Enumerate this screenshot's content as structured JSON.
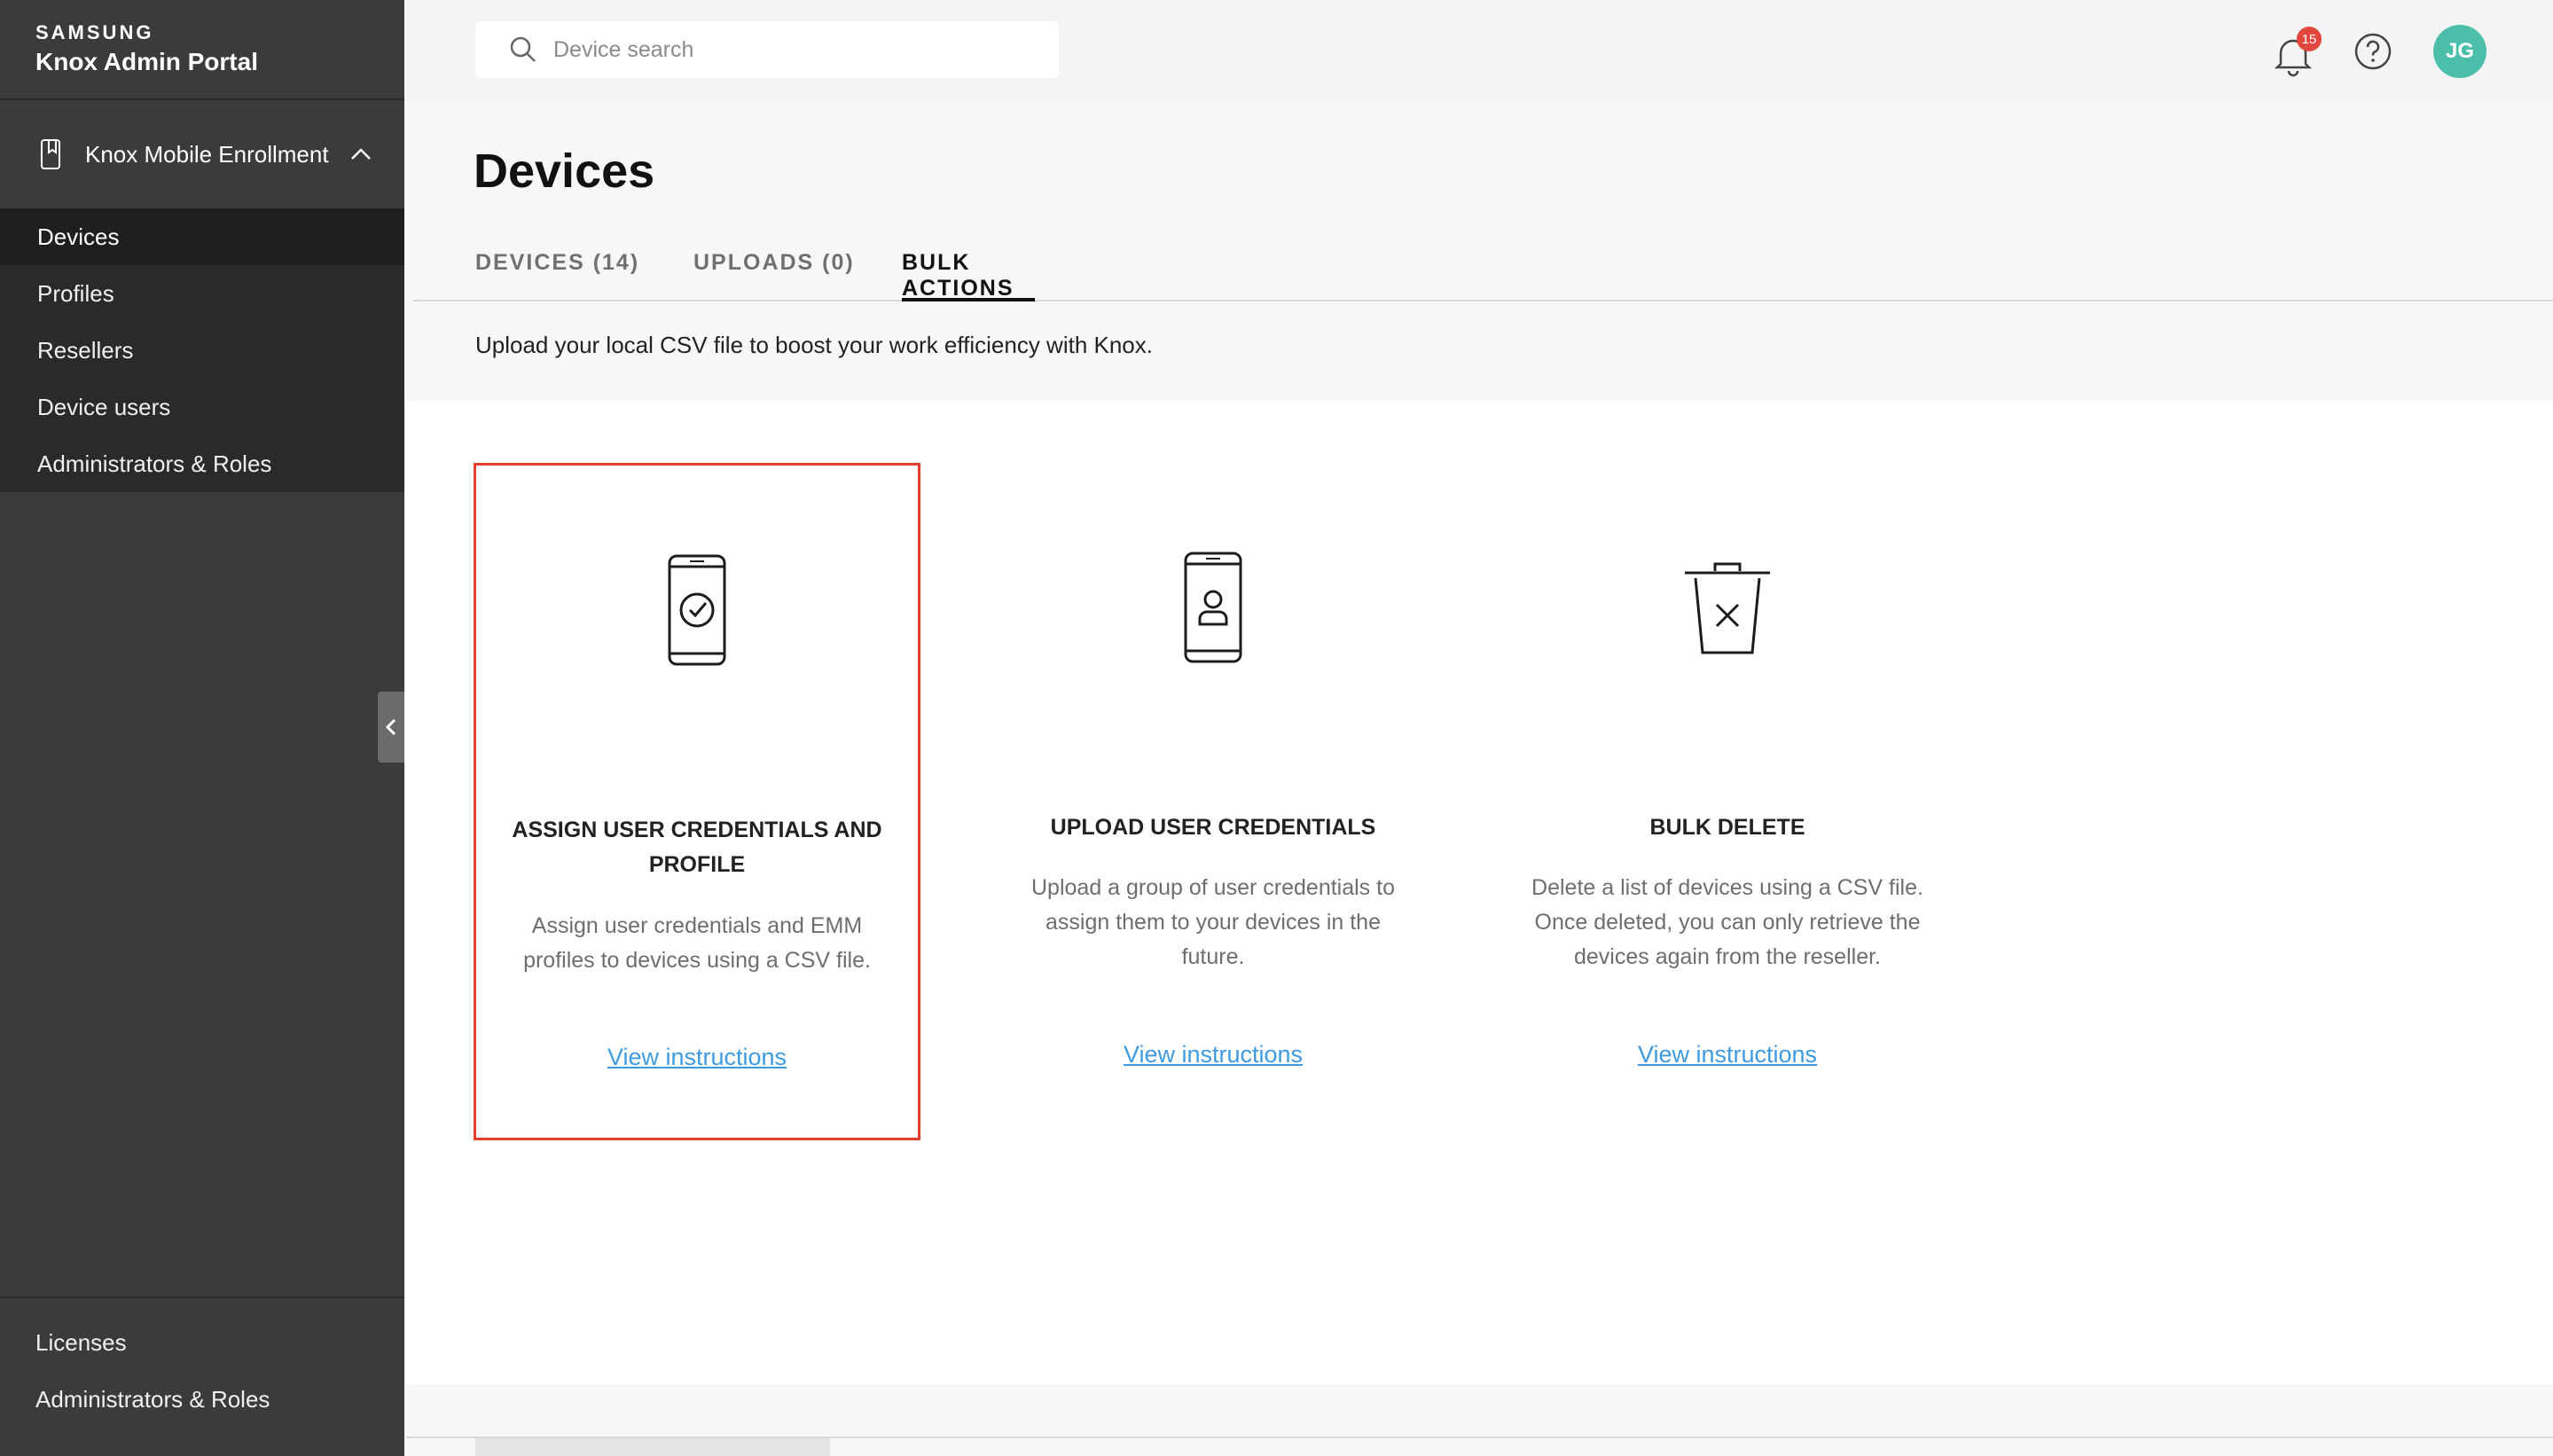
{
  "brand": {
    "company": "SAMSUNG",
    "product": "Knox Admin Portal"
  },
  "sidebar": {
    "section": {
      "label": "Knox Mobile Enrollment",
      "icon": "phone-bookmark-icon",
      "chevron": "chevron-up-icon"
    },
    "items": [
      {
        "label": "Devices",
        "active": true
      },
      {
        "label": "Profiles"
      },
      {
        "label": "Resellers"
      },
      {
        "label": "Device users"
      },
      {
        "label": "Administrators & Roles"
      }
    ],
    "bottom_items": [
      {
        "label": "Licenses"
      },
      {
        "label": "Administrators & Roles"
      }
    ]
  },
  "topbar": {
    "search_placeholder": "Device search",
    "notification_count": "15",
    "avatar_initials": "JG"
  },
  "page": {
    "title": "Devices",
    "tabs": [
      {
        "label": "DEVICES (14)"
      },
      {
        "label": "UPLOADS (0)"
      },
      {
        "label": "BULK ACTIONS",
        "active": true
      }
    ],
    "subtitle": "Upload your local CSV file to boost your work efficiency with Knox."
  },
  "cards": [
    {
      "title": "ASSIGN USER CREDENTIALS AND PROFILE",
      "description": "Assign user credentials and EMM profiles to devices using a CSV file.",
      "link": "View instructions",
      "icon": "phone-check-icon",
      "selected": true
    },
    {
      "title": "UPLOAD USER CREDENTIALS",
      "description": "Upload a group of user credentials to assign them to your devices in the future.",
      "link": "View instructions",
      "icon": "phone-user-icon"
    },
    {
      "title": "BULK DELETE",
      "description": "Delete a list of devices using a CSV file. Once deleted, you can only retrieve the devices again from the reseller.",
      "link": "View instructions",
      "icon": "trash-x-icon"
    }
  ],
  "colors": {
    "sidebar": "#3a3b3d",
    "accent_link": "#3e9be0",
    "selected_border": "#e3402f",
    "avatar": "#4bbfa9",
    "badge": "#e2463c"
  }
}
